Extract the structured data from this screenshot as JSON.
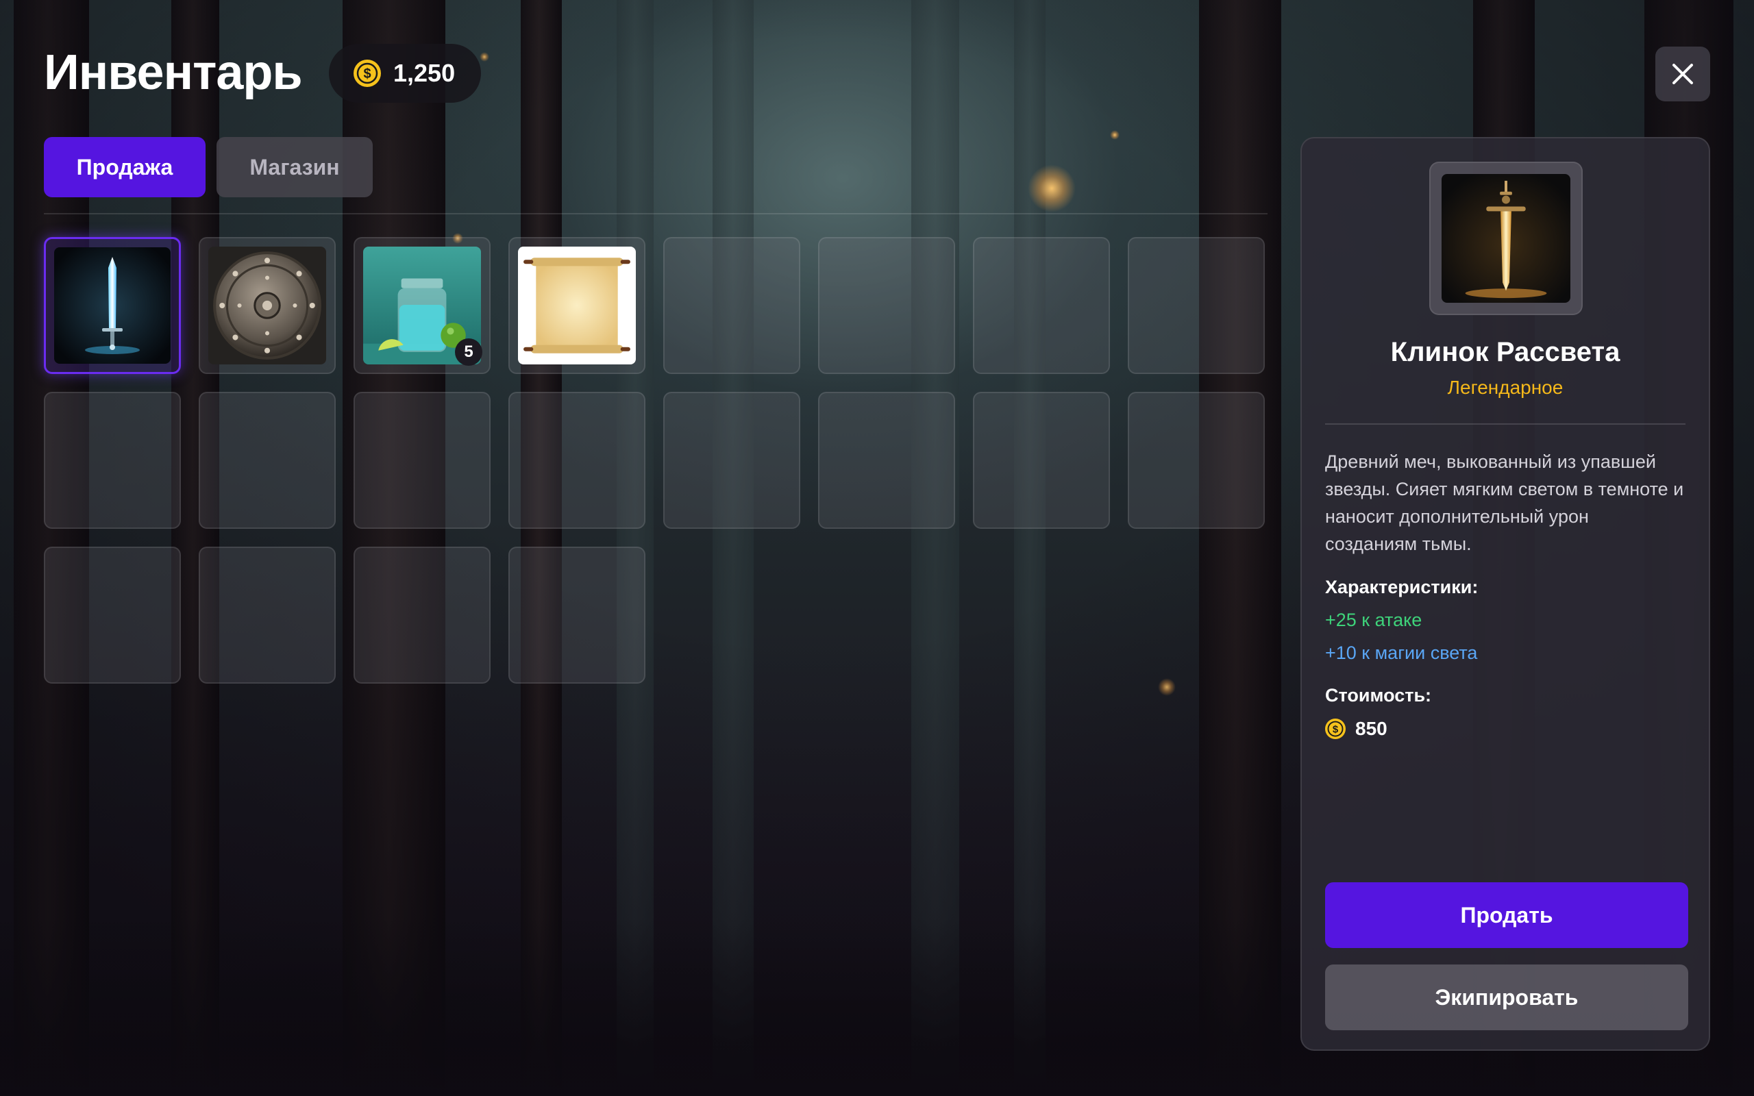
{
  "header": {
    "title": "Инвентарь",
    "gold": "1,250",
    "close_icon": "close-icon"
  },
  "tabs": [
    {
      "label": "Продажа",
      "active": true
    },
    {
      "label": "Магазин",
      "active": false
    }
  ],
  "inventory": {
    "slot_count": 20,
    "items": [
      {
        "slot": 1,
        "name": "sword",
        "icon": "glowing-sword-icon",
        "selected": true
      },
      {
        "slot": 2,
        "name": "shield",
        "icon": "round-shield-icon"
      },
      {
        "slot": 3,
        "name": "potion",
        "icon": "potion-jar-icon",
        "quantity": "5"
      },
      {
        "slot": 4,
        "name": "scroll",
        "icon": "scroll-icon"
      }
    ]
  },
  "details": {
    "name": "Клинок Рассвета",
    "rarity": "Легендарное",
    "description": "Древний меч, выкованный из упавшей звезды. Сияет мягким светом в темноте и наносит дополнительный урон созданиям тьмы.",
    "stats_heading": "Характеристики:",
    "stats": [
      "+25 к атаке",
      "+10 к магии света"
    ],
    "cost_heading": "Стоимость:",
    "cost": "850",
    "sell_label": "Продать",
    "equip_label": "Экипировать"
  },
  "colors": {
    "accent": "#5515e0",
    "rarity_legendary": "#f5b81a",
    "stat_attack": "#3ed37a",
    "stat_magic": "#5aa6f5",
    "coin": "#f6c21c"
  }
}
